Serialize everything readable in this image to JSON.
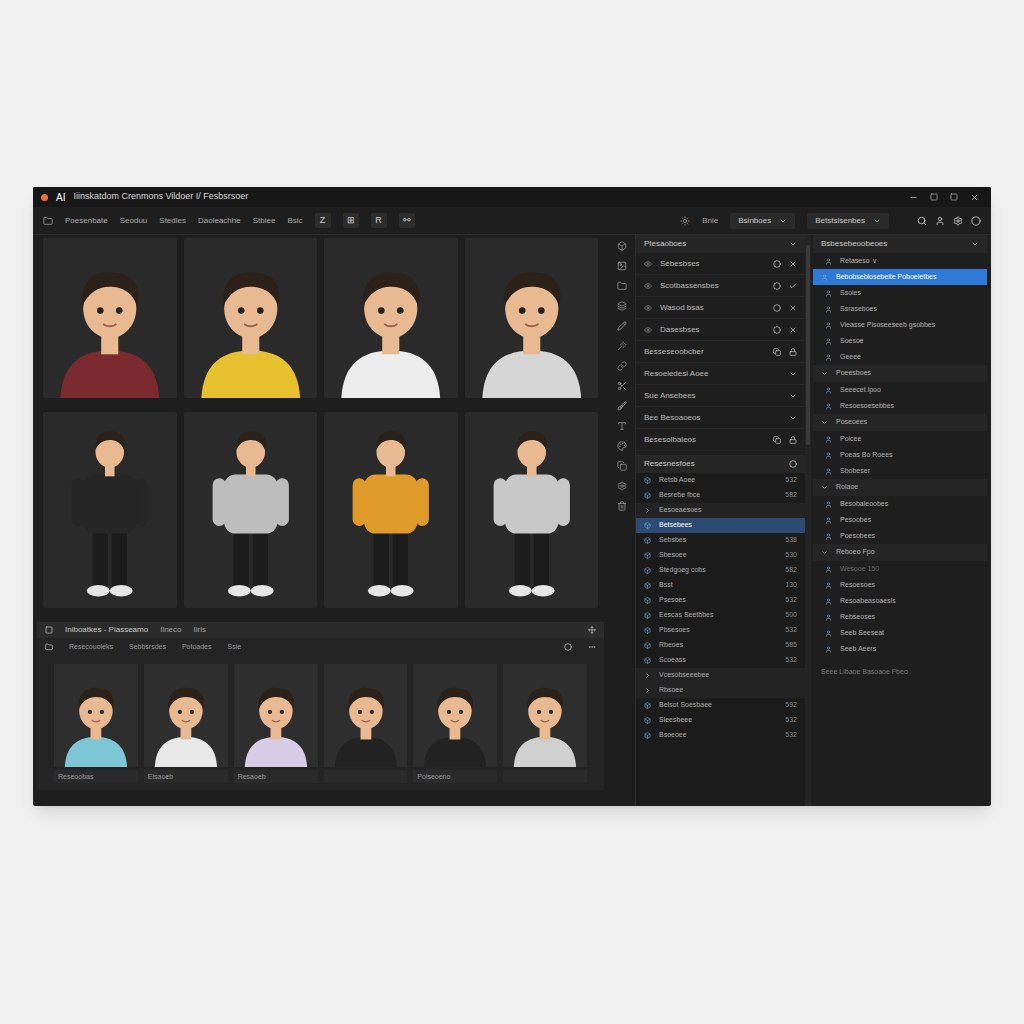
{
  "window": {
    "logo": "AI",
    "title": "Iiinskatdom Crenmons Vildoer I/ Fesbsrsoer"
  },
  "toolbar": {
    "menu": [
      "Poesenbate",
      "Seoduu",
      "Stedles",
      "Daoleachhe",
      "Stbiee",
      "Bsic"
    ],
    "tools": [
      "Z",
      "⊞",
      "R",
      "⚯"
    ],
    "right_label": "Bnie",
    "dropdowns": [
      "Bsinboes",
      "Betstslsenbes"
    ]
  },
  "avatars": [
    {
      "kind": "bust",
      "color": "#7a2a2e"
    },
    {
      "kind": "bust",
      "color": "#e8c22e"
    },
    {
      "kind": "bust",
      "color": "#ececec"
    },
    {
      "kind": "bust",
      "color": "#d6d6d6"
    },
    {
      "kind": "full",
      "color": "#262626"
    },
    {
      "kind": "full",
      "color": "#bdbdbd"
    },
    {
      "kind": "full",
      "color": "#e09a2a"
    },
    {
      "kind": "full",
      "color": "#c8c8c8"
    }
  ],
  "library": {
    "title": "Iniboatkes - Piasseamo",
    "tabs": [
      "Ilneco",
      "Iirls"
    ],
    "filters": [
      "Resecouoleks",
      "Sebbsrsdes",
      "Potoades",
      "Ssie"
    ],
    "items": [
      {
        "caption": "Reseoobas",
        "color": "#7cc6d6"
      },
      {
        "caption": "Eisaoeb",
        "color": "#e8e8e8"
      },
      {
        "caption": "Resaoeb",
        "color": "#d8cde6"
      },
      {
        "caption": "",
        "color": "#222222"
      },
      {
        "caption": "Poiseoeno",
        "color": "#222222"
      },
      {
        "caption": "",
        "color": "#d0d0d0"
      }
    ]
  },
  "properties": {
    "title": "Ptesaoboes",
    "rows": [
      {
        "label": "Sebesbses",
        "kind": "toggle",
        "checked": false
      },
      {
        "label": "Scotbassensbes",
        "kind": "toggle",
        "checked": true
      },
      {
        "label": "Wasod bsas",
        "kind": "toggle",
        "checked": false
      },
      {
        "label": "Dasesbses",
        "kind": "toggle",
        "checked": false
      },
      {
        "label": "Besseseoobcber",
        "kind": "tools",
        "checked": false
      },
      {
        "label": "Resoeledesi Aoee",
        "kind": "expander",
        "checked": false
      },
      {
        "label": "Sue Ansebees",
        "kind": "expander",
        "checked": false
      },
      {
        "label": "Bee Besoaoeos",
        "kind": "expander",
        "checked": false
      },
      {
        "label": "Besesolbaleos",
        "kind": "tools",
        "checked": false
      }
    ]
  },
  "layers": {
    "title": "Resesnesfoes",
    "rows": [
      {
        "label": "Retsb Aoee",
        "value": "532",
        "kind": "item",
        "selected": false
      },
      {
        "label": "Besrebe fbce",
        "value": "582",
        "kind": "item",
        "selected": false
      },
      {
        "label": "Eesoeaesoes",
        "value": "",
        "kind": "section",
        "selected": false
      },
      {
        "label": "Betsebees",
        "value": "",
        "kind": "item",
        "selected": true
      },
      {
        "label": "Sebsbes",
        "value": "538",
        "kind": "item",
        "selected": false
      },
      {
        "label": "Sbesoee",
        "value": "530",
        "kind": "item",
        "selected": false
      },
      {
        "label": "Stedgoeg cobs",
        "value": "582",
        "kind": "item",
        "selected": false
      },
      {
        "label": "Bsst",
        "value": "130",
        "kind": "item",
        "selected": false
      },
      {
        "label": "Psesoes",
        "value": "532",
        "kind": "item",
        "selected": false
      },
      {
        "label": "Eescas Seetbbes",
        "value": "500",
        "kind": "item",
        "selected": false
      },
      {
        "label": "Pbsesoes",
        "value": "532",
        "kind": "item",
        "selected": false
      },
      {
        "label": "Rbeoes",
        "value": "585",
        "kind": "item",
        "selected": false
      },
      {
        "label": "Scoeass",
        "value": "532",
        "kind": "item",
        "selected": false
      },
      {
        "label": "Vcesobseeebee",
        "value": "",
        "kind": "section",
        "selected": false
      },
      {
        "label": "Rbsoee",
        "value": "",
        "kind": "section",
        "selected": false
      },
      {
        "label": "Belsot Soesbaee",
        "value": "592",
        "kind": "item",
        "selected": false
      },
      {
        "label": "Sleesbeee",
        "value": "532",
        "kind": "item",
        "selected": false
      },
      {
        "label": "Bsoeoee",
        "value": "532",
        "kind": "item",
        "selected": false
      }
    ]
  },
  "outline": {
    "title": "Bsbesebeoobeoes",
    "rows": [
      {
        "label": "Retaseso ∨",
        "kind": "item",
        "selected": false,
        "disabled": false
      },
      {
        "label": "Bebobseblosebeite Poboeletbes",
        "kind": "item",
        "selected": true,
        "disabled": false
      },
      {
        "label": "Ssoies",
        "kind": "item",
        "selected": false,
        "disabled": false
      },
      {
        "label": "Ssraseboes",
        "kind": "item",
        "selected": false,
        "disabled": false
      },
      {
        "label": "Vieasse Pisoseeseeb gsobbes",
        "kind": "item",
        "selected": false,
        "disabled": false
      },
      {
        "label": "Soesoe",
        "kind": "item",
        "selected": false,
        "disabled": false
      },
      {
        "label": "Geeee",
        "kind": "item",
        "selected": false,
        "disabled": false
      },
      {
        "label": "Poeesboes",
        "kind": "section",
        "selected": false,
        "disabled": false
      },
      {
        "label": "Seeecet.lpoo",
        "kind": "item",
        "selected": false,
        "disabled": false
      },
      {
        "label": "Resoesoesebbes",
        "kind": "item",
        "selected": false,
        "disabled": false
      },
      {
        "label": "Poseoees",
        "kind": "section",
        "selected": false,
        "disabled": false
      },
      {
        "label": "Poicee",
        "kind": "item",
        "selected": false,
        "disabled": false
      },
      {
        "label": "Poeas Bo Roees",
        "kind": "item",
        "selected": false,
        "disabled": false
      },
      {
        "label": "Sbobeser",
        "kind": "item",
        "selected": false,
        "disabled": false
      },
      {
        "label": "Rolaoe",
        "kind": "section",
        "selected": false,
        "disabled": false
      },
      {
        "label": "Besobaleoobes",
        "kind": "item",
        "selected": false,
        "disabled": false
      },
      {
        "label": "Pesoobes",
        "kind": "item",
        "selected": false,
        "disabled": false
      },
      {
        "label": "Poesobees",
        "kind": "item",
        "selected": false,
        "disabled": false
      },
      {
        "label": "Reboeo Fpo",
        "kind": "section",
        "selected": false,
        "disabled": false
      },
      {
        "label": "Wesooe 150",
        "kind": "item",
        "selected": false,
        "disabled": true
      },
      {
        "label": "Resoesoes",
        "kind": "item",
        "selected": false,
        "disabled": false
      },
      {
        "label": "Resoabeasoaesls",
        "kind": "item",
        "selected": false,
        "disabled": false
      },
      {
        "label": "Rebseoses",
        "kind": "item",
        "selected": false,
        "disabled": false
      },
      {
        "label": "Seeb Seeseat",
        "kind": "item",
        "selected": false,
        "disabled": false
      },
      {
        "label": "Seeb Aeers",
        "kind": "item",
        "selected": false,
        "disabled": false
      }
    ],
    "footer": "Seee Libaoe Basoaoe Fbeo"
  }
}
